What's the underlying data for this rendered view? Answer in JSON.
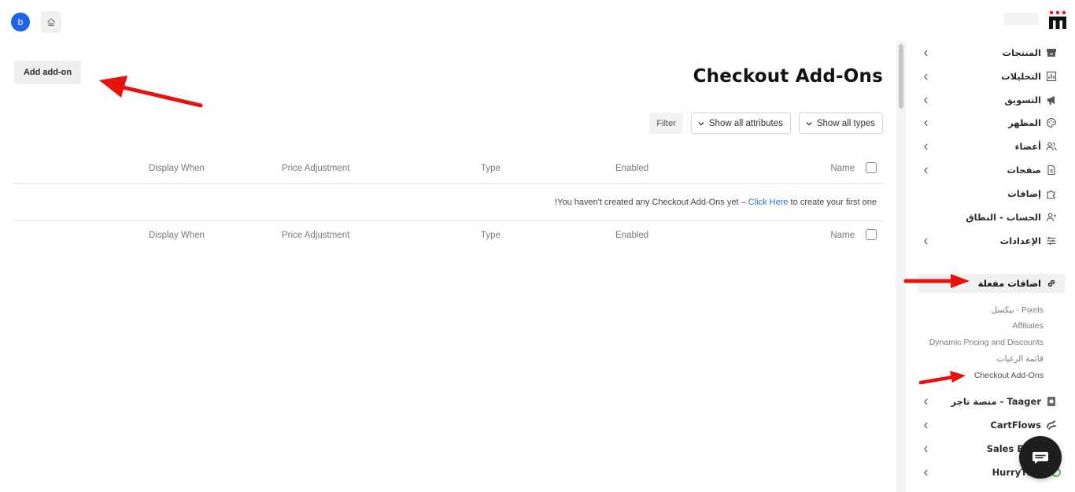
{
  "topbar": {
    "avatar_letter": "b"
  },
  "main": {
    "add_button": "Add add-on",
    "title": "Checkout Add-Ons",
    "filter_button": "Filter",
    "attributes_select": "Show all attributes",
    "types_select": "Show all types",
    "columns": {
      "name": "Name",
      "enabled": "Enabled",
      "type": "Type",
      "price_adjustment": "Price Adjustment",
      "display_when": "Display When"
    },
    "empty_message_prefix": "!You haven't created any Checkout Add-Ons yet – ",
    "empty_message_link": "Click Here",
    "empty_message_suffix": " to create your first one"
  },
  "sidebar": {
    "items": [
      {
        "label": "المنتجات",
        "icon": "archive-icon",
        "has_chevron": true
      },
      {
        "label": "التحليلات",
        "icon": "analytics-icon",
        "has_chevron": true
      },
      {
        "label": "التسويق",
        "icon": "megaphone-icon",
        "has_chevron": true
      },
      {
        "label": "المظهر",
        "icon": "palette-icon",
        "has_chevron": true
      },
      {
        "label": "أعضاء",
        "icon": "users-icon",
        "has_chevron": true
      },
      {
        "label": "صفحات",
        "icon": "page-icon",
        "has_chevron": true
      },
      {
        "label": "إضافات",
        "icon": "puzzle-icon",
        "has_chevron": false
      },
      {
        "label": "الحساب - النطاق",
        "icon": "account-icon",
        "has_chevron": false
      },
      {
        "label": "الإعدادات",
        "icon": "sliders-icon",
        "has_chevron": true
      }
    ],
    "active_item": {
      "label": "اضافات مفعلة",
      "icon": "link-icon"
    },
    "sub_items": [
      "بيكسل - Pixels",
      "Affiliates",
      "Dynamic Pricing and Discounts",
      "قائمة الرغبات",
      "Checkout Add-Ons"
    ],
    "bottom_items": [
      {
        "label": "Taager - منصة تاجر",
        "icon": "taager-icon"
      },
      {
        "label": "CartFlows",
        "icon": "cartflows-icon"
      },
      {
        "label": "Sales Bo",
        "icon": "sales-booster-icon"
      },
      {
        "label": "HurryTi",
        "icon": "hurrytimer-icon"
      }
    ]
  },
  "colors": {
    "accent_blue": "#1e63e9",
    "link_blue": "#2a6fdb",
    "arrow_red": "#e8120c",
    "chat_bg": "#1e1e1e"
  }
}
